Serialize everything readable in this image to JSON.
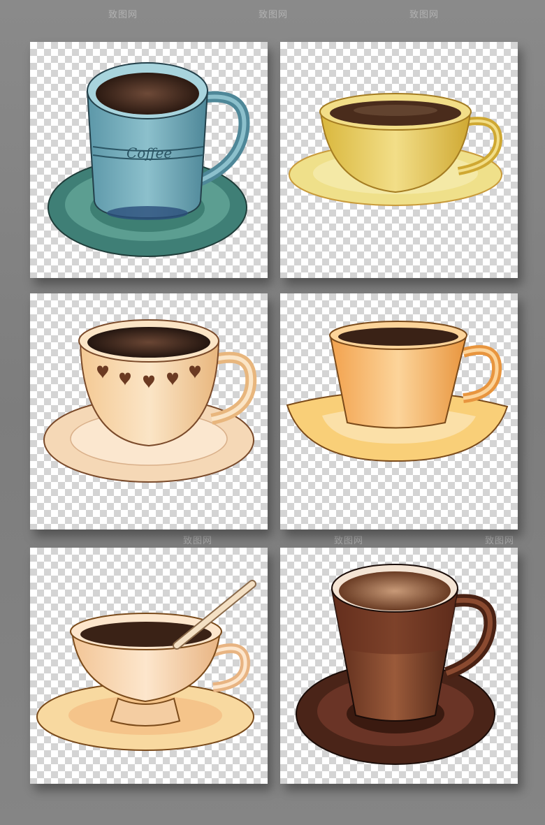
{
  "watermark": {
    "text": "致图网"
  },
  "cups": [
    {
      "name": "blue-coffee-mug",
      "label": "Coffee",
      "color": "#6aa3b3",
      "saucer": "#4f9083"
    },
    {
      "name": "yellow-teacup",
      "color": "#e8cc5c",
      "saucer": "#efdf86"
    },
    {
      "name": "heart-teacup",
      "color": "#f6d6aa",
      "saucer": "#f7dcbc"
    },
    {
      "name": "orange-cup",
      "color": "#f7b868",
      "saucer": "#f9cf78"
    },
    {
      "name": "cream-cup-with-spoon",
      "color": "#f8d6b0",
      "saucer": "#f8dca3"
    },
    {
      "name": "brown-cup",
      "color": "#6b3220",
      "saucer": "#4a2418"
    }
  ]
}
